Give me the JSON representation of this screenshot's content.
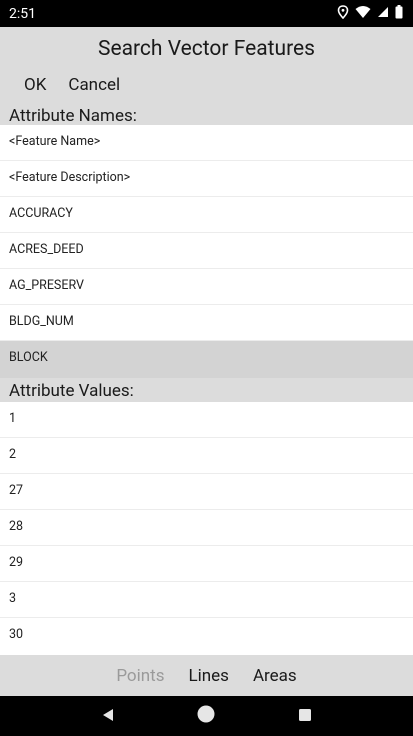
{
  "status_bar": {
    "time": "2:51"
  },
  "header": {
    "title": "Search Vector Features",
    "ok_label": "OK",
    "cancel_label": "Cancel"
  },
  "attribute_names": {
    "heading": "Attribute Names:",
    "items": [
      "<Feature Name>",
      "<Feature Description>",
      "ACCURACY",
      "ACRES_DEED",
      "AG_PRESERV",
      "BLDG_NUM",
      "BLOCK"
    ],
    "selected": "BLOCK"
  },
  "attribute_values": {
    "heading": "Attribute Values:",
    "items": [
      "1",
      "2",
      "27",
      "28",
      "29",
      "3",
      "30"
    ]
  },
  "tabs": {
    "points": "Points",
    "lines": "Lines",
    "areas": "Areas",
    "points_state": "disabled"
  },
  "icons": {
    "location": "location-icon",
    "wifi": "wifi-icon",
    "signal": "signal-icon",
    "battery": "battery-icon",
    "back": "back-icon",
    "home": "home-icon",
    "recents": "recents-icon"
  }
}
